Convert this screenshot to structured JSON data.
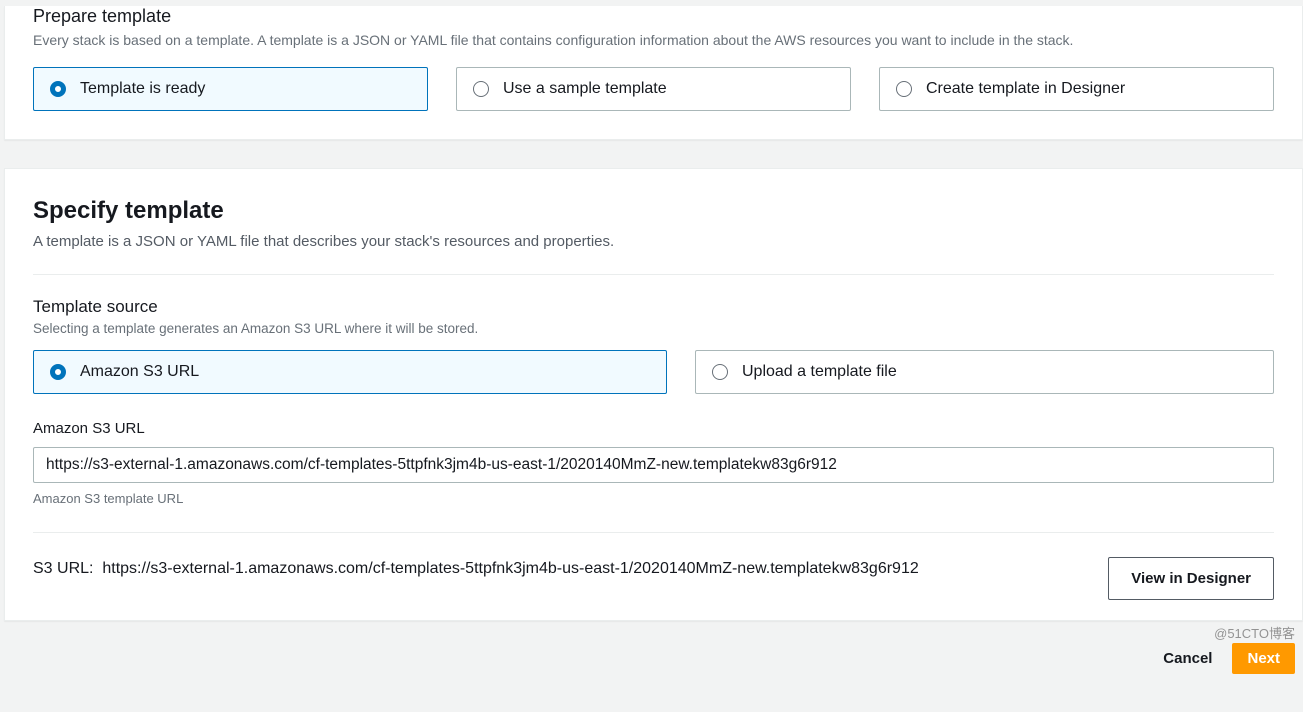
{
  "prepare": {
    "title": "Prepare template",
    "desc": "Every stack is based on a template. A template is a JSON or YAML file that contains configuration information about the AWS resources you want to include in the stack.",
    "options": [
      {
        "label": "Template is ready",
        "selected": true
      },
      {
        "label": "Use a sample template",
        "selected": false
      },
      {
        "label": "Create template in Designer",
        "selected": false
      }
    ]
  },
  "specify": {
    "title": "Specify template",
    "desc": "A template is a JSON or YAML file that describes your stack's resources and properties.",
    "source": {
      "title": "Template source",
      "desc": "Selecting a template generates an Amazon S3 URL where it will be stored.",
      "options": [
        {
          "label": "Amazon S3 URL",
          "selected": true
        },
        {
          "label": "Upload a template file",
          "selected": false
        }
      ]
    },
    "s3url": {
      "label": "Amazon S3 URL",
      "value": "https://s3-external-1.amazonaws.com/cf-templates-5ttpfnk3jm4b-us-east-1/2020140MmZ-new.templatekw83g6r912",
      "hint": "Amazon S3 template URL"
    },
    "resolved": {
      "label": "S3 URL:",
      "value": "https://s3-external-1.amazonaws.com/cf-templates-5ttpfnk3jm4b-us-east-1/2020140MmZ-new.templatekw83g6r912"
    },
    "designer_button": "View in Designer"
  },
  "footer": {
    "cancel": "Cancel",
    "next": "Next"
  },
  "watermark": "@51CTO博客"
}
